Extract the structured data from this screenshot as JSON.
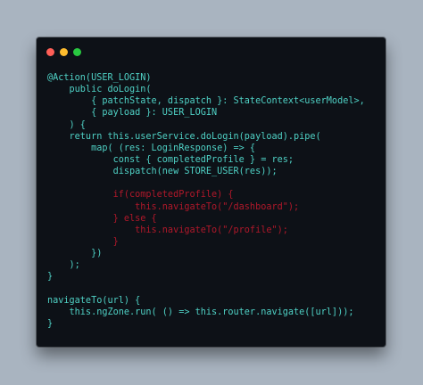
{
  "window": {
    "buttons": [
      {
        "name": "close",
        "color": "#ff5f57"
      },
      {
        "name": "minimize",
        "color": "#febc2e"
      },
      {
        "name": "maximize",
        "color": "#28c840"
      }
    ]
  },
  "colors": {
    "code": "#4fd1c5",
    "highlight": "#b0182a"
  },
  "code_lines": [
    {
      "text": "@Action(USER_LOGIN)",
      "highlight": false
    },
    {
      "text": "    public doLogin(",
      "highlight": false
    },
    {
      "text": "        { patchState, dispatch }: StateContext<userModel>,",
      "highlight": false
    },
    {
      "text": "        { payload }: USER_LOGIN",
      "highlight": false
    },
    {
      "text": "    ) {",
      "highlight": false
    },
    {
      "text": "    return this.userService.doLogin(payload).pipe(",
      "highlight": false
    },
    {
      "text": "        map( (res: LoginResponse) => {",
      "highlight": false
    },
    {
      "text": "            const { completedProfile } = res;",
      "highlight": false
    },
    {
      "text": "            dispatch(new STORE_USER(res));",
      "highlight": false
    },
    {
      "text": "",
      "highlight": false
    },
    {
      "text": "            if(completedProfile) {",
      "highlight": true
    },
    {
      "text": "                this.navigateTo(\"/dashboard\");",
      "highlight": true
    },
    {
      "text": "            } else {",
      "highlight": true
    },
    {
      "text": "                this.navigateTo(\"/profile\");",
      "highlight": true
    },
    {
      "text": "            }",
      "highlight": true
    },
    {
      "text": "        })",
      "highlight": false
    },
    {
      "text": "    );",
      "highlight": false
    },
    {
      "text": "}",
      "highlight": false
    },
    {
      "text": "",
      "highlight": false
    },
    {
      "text": "navigateTo(url) {",
      "highlight": false
    },
    {
      "text": "    this.ngZone.run( () => this.router.navigate([url]));",
      "highlight": false
    },
    {
      "text": "}",
      "highlight": false
    }
  ]
}
